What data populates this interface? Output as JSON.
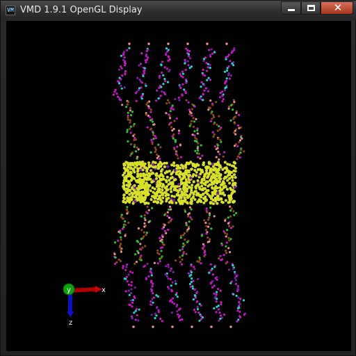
{
  "window": {
    "title": "VMD 1.9.1 OpenGL Display",
    "icon": "vmd-app-icon"
  },
  "controls": {
    "minimize": "minimize-icon",
    "maximize": "maximize-icon",
    "close": "close-icon"
  },
  "axes": {
    "x_label": "x",
    "y_label": "y",
    "z_label": "z",
    "x_color": "#c00000",
    "y_color": "#00b000",
    "z_color": "#0000d0"
  },
  "colors": {
    "yellow": "#d8e02a",
    "magenta": "#c01ac0",
    "cyan": "#2ad0d0",
    "brown": "#8a4a1a",
    "pink": "#e89090",
    "green": "#30c030",
    "purple": "#7a20a0"
  }
}
